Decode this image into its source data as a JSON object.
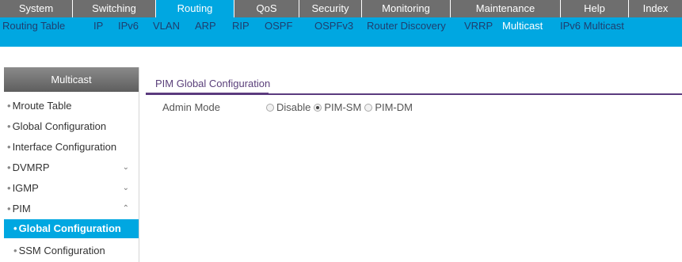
{
  "topnav": {
    "tabs": [
      {
        "label": "System"
      },
      {
        "label": "Switching"
      },
      {
        "label": "Routing",
        "active": true
      },
      {
        "label": "QoS"
      },
      {
        "label": "Security"
      },
      {
        "label": "Monitoring"
      },
      {
        "label": "Maintenance"
      },
      {
        "label": "Help"
      },
      {
        "label": "Index"
      }
    ]
  },
  "subnav": {
    "items": [
      {
        "label": "Routing Table"
      },
      {
        "label": "IP"
      },
      {
        "label": "IPv6"
      },
      {
        "label": "VLAN"
      },
      {
        "label": "ARP"
      },
      {
        "label": "RIP"
      },
      {
        "label": "OSPF"
      },
      {
        "label": "OSPFv3"
      },
      {
        "label": "Router Discovery"
      },
      {
        "label": "VRRP"
      },
      {
        "label": "Multicast",
        "active": true
      },
      {
        "label": "IPv6 Multicast"
      }
    ]
  },
  "sidebar": {
    "title": "Multicast",
    "items": [
      {
        "label": "Mroute Table"
      },
      {
        "label": "Global Configuration"
      },
      {
        "label": "Interface Configuration"
      },
      {
        "label": "DVMRP",
        "chevron": "⌄"
      },
      {
        "label": "IGMP",
        "chevron": "⌄"
      },
      {
        "label": "PIM",
        "chevron": "⌃"
      },
      {
        "label": "Global Configuration",
        "sub": true,
        "active": true
      },
      {
        "label": "SSM Configuration",
        "sub": true
      }
    ]
  },
  "main": {
    "section_title": "PIM Global Configuration",
    "admin_mode": {
      "label": "Admin Mode",
      "options": [
        {
          "label": "Disable",
          "checked": false
        },
        {
          "label": "PIM-SM",
          "checked": true
        },
        {
          "label": "PIM-DM",
          "checked": false
        }
      ]
    }
  },
  "colors": {
    "nav_gray": "#6e6e6e",
    "accent_blue": "#00a7e1",
    "section_purple": "#5b3a7e"
  }
}
